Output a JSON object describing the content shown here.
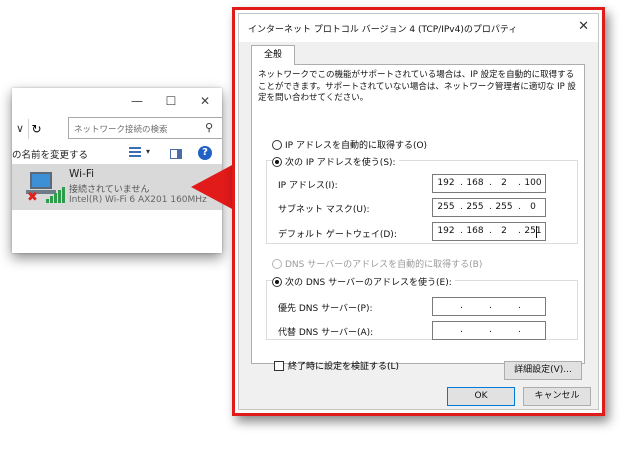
{
  "explorer": {
    "window_controls": [
      "—",
      "☐",
      "✕"
    ],
    "nav_back": "∨",
    "nav_refresh": "↻",
    "search_placeholder": "ネットワーク接続の検索",
    "rename_label": "の名前を変更する",
    "view_dropdown": "▾",
    "help": "?",
    "connection": {
      "name": "Wi-Fi",
      "status": "接続されていません",
      "adapter": "Intel(R) Wi-Fi 6 AX201 160MHz"
    }
  },
  "dialog": {
    "title": "インターネット プロトコル バージョン 4 (TCP/IPv4)のプロパティ",
    "close": "✕",
    "tab": "全般",
    "description": "ネットワークでこの機能がサポートされている場合は、IP 設定を自動的に取得することができます。サポートされていない場合は、ネットワーク管理者に適切な IP 設定を問い合わせてください。",
    "ip_auto": "IP アドレスを自動的に取得する(O)",
    "ip_manual": "次の IP アドレスを使う(S):",
    "ip_address_label": "IP アドレス(I):",
    "ip_address": [
      "192",
      "168",
      "2",
      "100"
    ],
    "subnet_label": "サブネット マスク(U):",
    "subnet": [
      "255",
      "255",
      "255",
      "0"
    ],
    "gateway_label": "デフォルト ゲートウェイ(D):",
    "gateway": [
      "192",
      "168",
      "2",
      "251"
    ],
    "dns_auto": "DNS サーバーのアドレスを自動的に取得する(B)",
    "dns_manual": "次の DNS サーバーのアドレスを使う(E):",
    "dns_preferred_label": "優先 DNS サーバー(P):",
    "dns_alternate_label": "代替 DNS サーバー(A):",
    "dot": ".",
    "validate_on_exit": "終了時に設定を検証する(L)",
    "advanced_button": "詳細設定(V)...",
    "ok_button": "OK",
    "cancel_button": "キャンセル"
  },
  "colors": {
    "highlight_red": "#e11a1a",
    "dialog_bg": "#f0f0f0",
    "selected_item_bg": "#d9d9d9",
    "primary_button_border": "#0078d7"
  },
  "icons": [
    "search-icon",
    "refresh-icon",
    "view-icon",
    "preview-pane-icon",
    "help-icon",
    "network-adapter-icon",
    "signal-bars-icon",
    "red-x-icon",
    "pointer-arrow-icon",
    "close-icon"
  ]
}
